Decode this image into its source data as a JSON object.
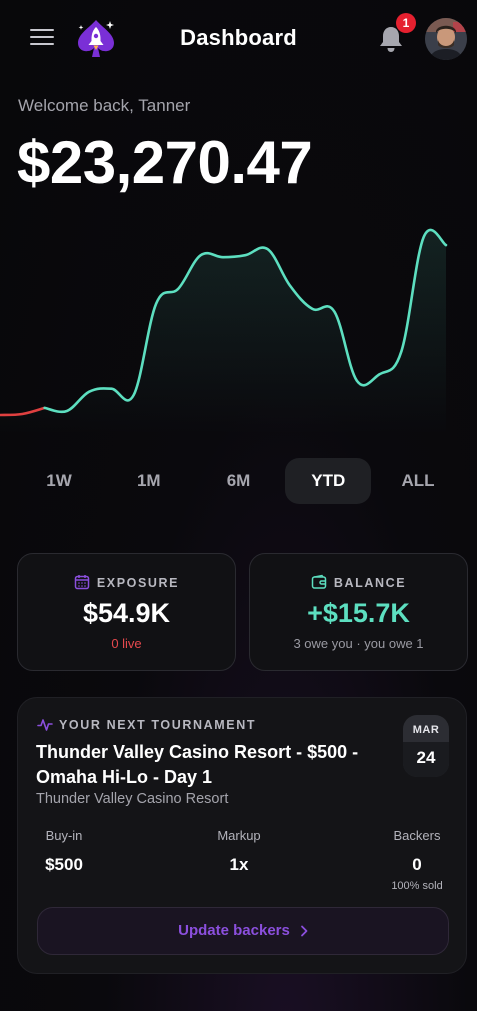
{
  "header": {
    "title": "Dashboard",
    "notification_count": "1",
    "menu_icon": "hamburger-menu-icon",
    "logo_icon": "rocket-spade-logo",
    "bell_icon": "bell-icon",
    "avatar_icon": "user-avatar"
  },
  "welcome": "Welcome back, Tanner",
  "total_balance": "$23,270.47",
  "chart_data": {
    "type": "line",
    "x": [
      0,
      5,
      10,
      15,
      20,
      25,
      30,
      35,
      40,
      45,
      50,
      55,
      60,
      65,
      70,
      75,
      80,
      85,
      90,
      95,
      100
    ],
    "values": [
      0,
      0.1,
      0.7,
      0.4,
      2.3,
      2.6,
      2.0,
      11.0,
      12.5,
      15.8,
      15.6,
      15.8,
      16.4,
      12.8,
      10.5,
      10.2,
      3.4,
      4.0,
      6.3,
      17.6,
      16.8
    ],
    "colors": {
      "up": "#5ddfc0",
      "down": "#e04040"
    },
    "grid": false
  },
  "ranges": [
    "1W",
    "1M",
    "6M",
    "YTD",
    "ALL"
  ],
  "active_range": "YTD",
  "exposure": {
    "label": "EXPOSURE",
    "value": "$54.9K",
    "sub": "0 live",
    "icon": "calendar-icon",
    "sub_color": "#e5484d"
  },
  "balance": {
    "label": "BALANCE",
    "value": "+$15.7K",
    "sub": "3 owe you · you owe 1",
    "icon": "wallet-icon",
    "value_color": "#5ddfc0"
  },
  "tournament": {
    "label": "YOUR NEXT TOURNAMENT",
    "icon": "activity-pulse-icon",
    "title": "Thunder Valley Casino Resort - $500 - Omaha Hi-Lo - Day 1",
    "venue": "Thunder Valley Casino Resort",
    "month": "MAR",
    "day": "24",
    "buyin_label": "Buy-in",
    "buyin_value": "$500",
    "markup_label": "Markup",
    "markup_value": "1x",
    "backers_label": "Backers",
    "backers_value": "0",
    "backers_sub": "100% sold",
    "update_label": "Update backers",
    "accent": "#8b4fdd"
  }
}
